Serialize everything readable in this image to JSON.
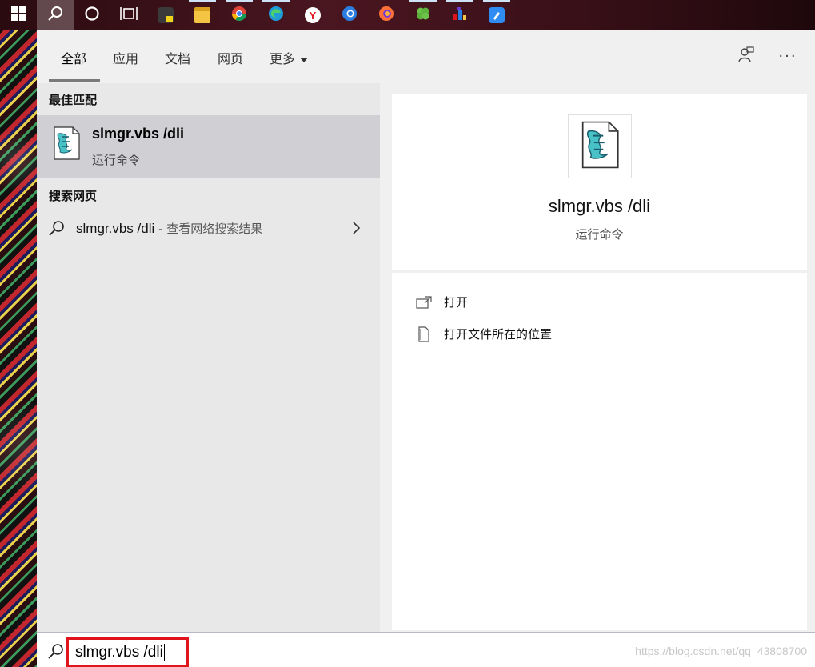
{
  "taskbar": {
    "icons": [
      {
        "name": "start-icon"
      },
      {
        "name": "search-icon"
      },
      {
        "name": "cortana-icon"
      },
      {
        "name": "task-view-icon"
      },
      {
        "name": "sticky-notes-icon"
      },
      {
        "name": "file-explorer-icon"
      },
      {
        "name": "chrome-icon"
      },
      {
        "name": "edge-icon"
      },
      {
        "name": "yandex-browser-icon"
      },
      {
        "name": "firefox-developer-icon"
      },
      {
        "name": "firefox-icon"
      },
      {
        "name": "clover-app-icon"
      },
      {
        "name": "paint-app-icon"
      },
      {
        "name": "blue-app-icon"
      }
    ]
  },
  "tabs": [
    {
      "label": "全部"
    },
    {
      "label": "应用"
    },
    {
      "label": "文档"
    },
    {
      "label": "网页"
    },
    {
      "label": "更多"
    }
  ],
  "header_icons": [
    "feedback-icon",
    "more-options-icon"
  ],
  "best_match": {
    "heading": "最佳匹配",
    "title": "slmgr.vbs /dli",
    "subtitle": "运行命令",
    "icon": "script-file-icon"
  },
  "web_search": {
    "heading": "搜索网页",
    "query": "slmgr.vbs /dli",
    "hint": " - 查看网络搜索结果"
  },
  "detail": {
    "title": "slmgr.vbs /dli",
    "subtitle": "运行命令",
    "actions": [
      {
        "label": "打开",
        "icon": "open-icon"
      },
      {
        "label": "打开文件所在的位置",
        "icon": "file-location-icon"
      }
    ]
  },
  "search": {
    "value": "slmgr.vbs /dli",
    "watermark": "https://blog.csdn.net/qq_43808700"
  },
  "colors": {
    "highlight": "#cfcfd4",
    "search_box_border": "#e0151b",
    "panel_bg": "#f0f0f0"
  }
}
